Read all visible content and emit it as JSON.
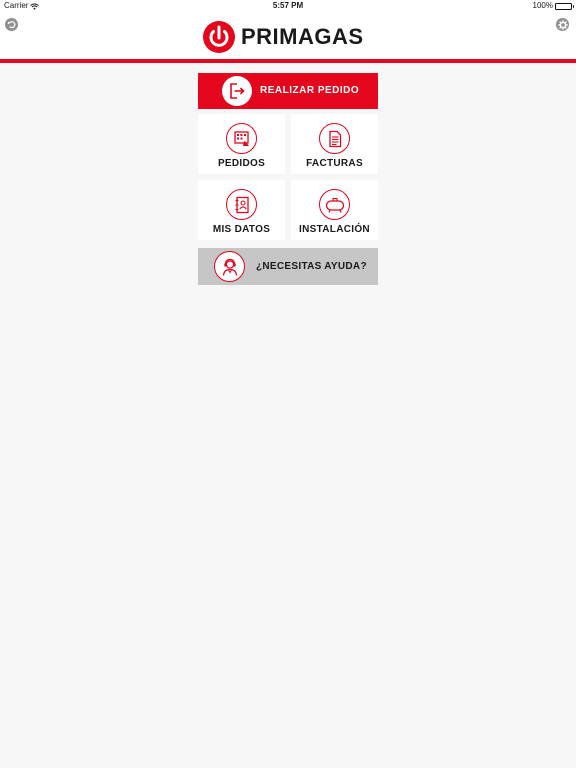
{
  "status_bar": {
    "carrier": "Carrier",
    "time": "5:57 PM",
    "battery": "100%",
    "wifi_icon": "wifi-icon",
    "battery_icon": "battery-icon"
  },
  "header": {
    "brand": "PRIMAGAS",
    "back_icon": "back-arrow-icon",
    "settings_icon": "gear-icon",
    "brand_color": "#e3061d"
  },
  "menu": {
    "primary": {
      "label": "REALIZAR PEDIDO",
      "icon": "exit-arrow-icon"
    },
    "tiles": [
      {
        "label": "PEDIDOS",
        "icon": "order-form-icon"
      },
      {
        "label": "FACTURAS",
        "icon": "invoice-document-icon"
      },
      {
        "label": "MIS DATOS",
        "icon": "contact-book-icon"
      },
      {
        "label": "INSTALACIÓN",
        "icon": "gas-tank-icon"
      }
    ],
    "help": {
      "label": "¿NECESITAS AYUDA?",
      "icon": "support-agent-icon"
    }
  },
  "colors": {
    "accent": "#e3061d",
    "background": "#f7f7f7",
    "help_background": "#c6c6c6"
  }
}
